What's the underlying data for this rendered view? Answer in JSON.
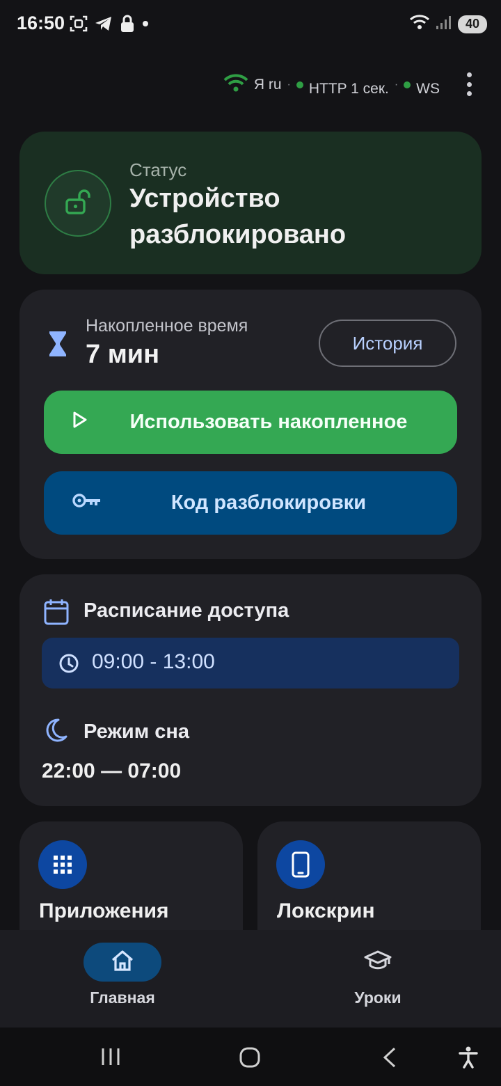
{
  "status_bar": {
    "time": "16:50",
    "battery": "40"
  },
  "connection": {
    "lang": "Я ru",
    "http": "HTTP 1 сек.",
    "ws": "WS",
    "separator": "·"
  },
  "status_card": {
    "label": "Статус",
    "value": "Устройство разблокировано"
  },
  "time_card": {
    "label": "Накопленное время",
    "value": "7 мин",
    "history_button": "История",
    "use_button": "Использовать накопленное",
    "code_button": "Код разблокировки"
  },
  "schedule": {
    "title": "Расписание доступа",
    "slot": "09:00 - 13:00",
    "sleep_title": "Режим сна",
    "sleep_range": "22:00 — 07:00"
  },
  "tiles": {
    "apps": "Приложения",
    "lockscreen": "Локскрин"
  },
  "bottom_nav": {
    "home": "Главная",
    "lessons": "Уроки"
  },
  "colors": {
    "background": "#131316",
    "status_card": "#1a2f22",
    "accent_green": "#34a853",
    "accent_blue": "#004a7f",
    "slot_blue": "#16305e"
  }
}
